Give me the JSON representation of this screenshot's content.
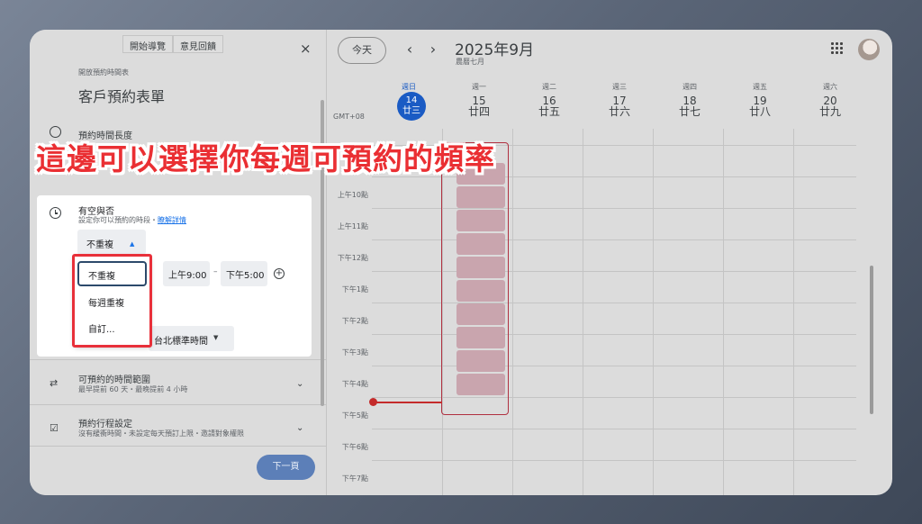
{
  "panel": {
    "tabs": [
      "開始導覽",
      "意見回饋"
    ],
    "close_label": "×",
    "page_label": "開放預約時間表",
    "page_title": "客戶預約表單",
    "duration_title": "預約時間長度",
    "availability": {
      "title": "有空與否",
      "subtitle": "設定你可以預約的時段・",
      "learn_more": "瞭解詳情",
      "repeat_value": "不重複",
      "start_time": "上午9:00",
      "end_time": "下午5:00",
      "dash": "–",
      "timezone": "台北標準時間"
    },
    "repeat_menu": [
      "不重複",
      "每週重複",
      "自訂..."
    ],
    "sections": [
      {
        "title": "可預約的時間範圍",
        "subtitle": "最早提前 60 天・最晚提前 4 小時"
      },
      {
        "title": "預約行程設定",
        "subtitle": "沒有緩衝時間・未設定每天預訂上限・邀請對象權限"
      }
    ],
    "next_label": "下一頁"
  },
  "calendar": {
    "today_label": "今天",
    "prev_label": "‹",
    "next_label": "›",
    "month_title": "2025年9月",
    "lunar_month": "農曆七月",
    "gmt_label": "GMT+08",
    "days": [
      {
        "name": "週日",
        "num": "14",
        "lunar": "廿三"
      },
      {
        "name": "週一",
        "num": "15",
        "lunar": "廿四"
      },
      {
        "name": "週二",
        "num": "16",
        "lunar": "廿五"
      },
      {
        "name": "週三",
        "num": "17",
        "lunar": "廿六"
      },
      {
        "name": "週四",
        "num": "18",
        "lunar": "廿七"
      },
      {
        "name": "週五",
        "num": "19",
        "lunar": "廿八"
      },
      {
        "name": "週六",
        "num": "20",
        "lunar": "廿九"
      }
    ],
    "hours": [
      "上午10點",
      "上午11點",
      "下午12點",
      "下午1點",
      "下午2點",
      "下午3點",
      "下午4點",
      "下午5點",
      "下午6點",
      "下午7點"
    ]
  },
  "annotation": "這邊可以選擇你每週可預約的頻率",
  "colors": {
    "accent": "#1a73e8",
    "highlight": "#e8303a",
    "today": "#1a5bc4"
  }
}
